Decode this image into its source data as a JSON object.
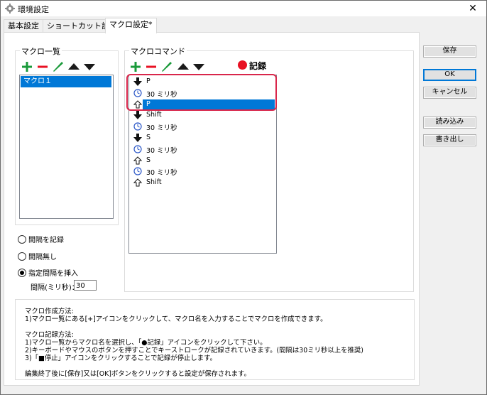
{
  "window": {
    "title": "環境設定",
    "close_glyph": "✕"
  },
  "tabs": [
    "基本設定",
    "ショートカット設定",
    "マクロ設定*"
  ],
  "macro_list": {
    "label": "マクロ一覧",
    "items": [
      "マクロ１"
    ]
  },
  "macro_commands": {
    "label": "マクロコマンド",
    "record_label": "記録",
    "items": [
      {
        "icon": "key-down-icon",
        "text": "P"
      },
      {
        "icon": "clock-icon",
        "text": "30 ミリ秒"
      },
      {
        "icon": "key-up-icon",
        "text": "P"
      },
      {
        "icon": "key-down-icon",
        "text": "Shift"
      },
      {
        "icon": "clock-icon",
        "text": "30 ミリ秒"
      },
      {
        "icon": "key-down-icon",
        "text": "S"
      },
      {
        "icon": "clock-icon",
        "text": "30 ミリ秒"
      },
      {
        "icon": "key-up-icon",
        "text": "S"
      },
      {
        "icon": "clock-icon",
        "text": "30 ミリ秒"
      },
      {
        "icon": "key-up-icon",
        "text": "Shift"
      }
    ]
  },
  "interval": {
    "options": [
      "間隔を記録",
      "間隔無し",
      "指定間隔を挿入"
    ],
    "selected": "指定間隔を挿入",
    "field_label": "間隔(ミリ秒)：",
    "field_value": "30"
  },
  "help": {
    "lines": [
      "マクロ作成方法:",
      "1)マクロ一覧にある[+]アイコンをクリックして、マクロ名を入力することでマクロを作成できます。",
      "",
      "マクロ記録方法:",
      "1)マクロ一覧からマクロ名を選択し、「●記録」アイコンをクリックして下さい。",
      "2)キーボードやマウスのボタンを押すことでキーストロークが記録されていきます。(間隔は30ミリ秒以上を推奨)",
      "3)「■停止」アイコンをクリックすることで記録が停止します。",
      "",
      "編集終了後に[保存]又は[OK]ボタンをクリックすると設定が保存されます。"
    ]
  },
  "buttons": {
    "save": "保存",
    "ok": "OK",
    "cancel": "キャンセル",
    "import": "読み込み",
    "export": "書き出し"
  },
  "colors": {
    "add": "#1a9a3a",
    "remove": "#e81123",
    "edit": "#1a9a3a",
    "select": "#0078d7",
    "record": "#e81123",
    "highlight": "#d9264b"
  }
}
